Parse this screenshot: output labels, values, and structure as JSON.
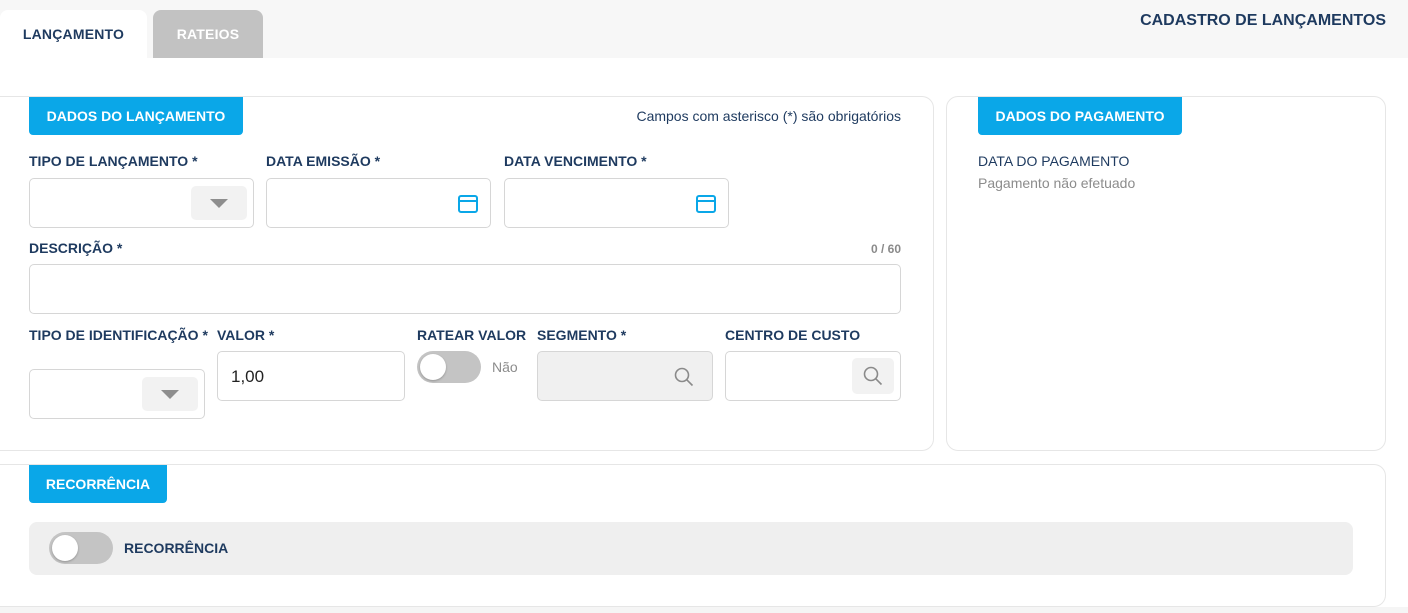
{
  "page_title": "CADASTRO DE LANÇAMENTOS",
  "tabs": [
    {
      "label": "LANÇAMENTO",
      "active": true
    },
    {
      "label": "RATEIOS",
      "active": false
    }
  ],
  "dados_lancamento": {
    "header": "DADOS DO LANÇAMENTO",
    "required_note": "Campos com asterisco (*) são obrigatórios",
    "tipo_lancamento": {
      "label": "TIPO DE LANÇAMENTO *",
      "value": ""
    },
    "data_emissao": {
      "label": "DATA EMISSÃO *",
      "value": ""
    },
    "data_vencimento": {
      "label": "DATA VENCIMENTO *",
      "value": ""
    },
    "descricao": {
      "label": "DESCRIÇÃO *",
      "value": "",
      "counter": "0 / 60"
    },
    "tipo_identificacao": {
      "label": "TIPO DE IDENTIFICAÇÃO *",
      "value": ""
    },
    "valor": {
      "label": "VALOR *",
      "value": "1,00"
    },
    "ratear_valor": {
      "label": "RATEAR VALOR",
      "state_label": "Não",
      "on": false
    },
    "segmento": {
      "label": "SEGMENTO *",
      "value": ""
    },
    "centro_custo": {
      "label": "CENTRO DE CUSTO",
      "value": ""
    }
  },
  "dados_pagamento": {
    "header": "DADOS DO PAGAMENTO",
    "data_label": "DATA DO PAGAMENTO",
    "data_value": "Pagamento não efetuado"
  },
  "recorrencia": {
    "header": "RECORRÊNCIA",
    "toggle_label": "RECORRÊNCIA",
    "on": false
  },
  "colors": {
    "accent": "#0aa7e8",
    "text": "#1e3a5f",
    "tab_inactive": "#c2c2c2"
  }
}
